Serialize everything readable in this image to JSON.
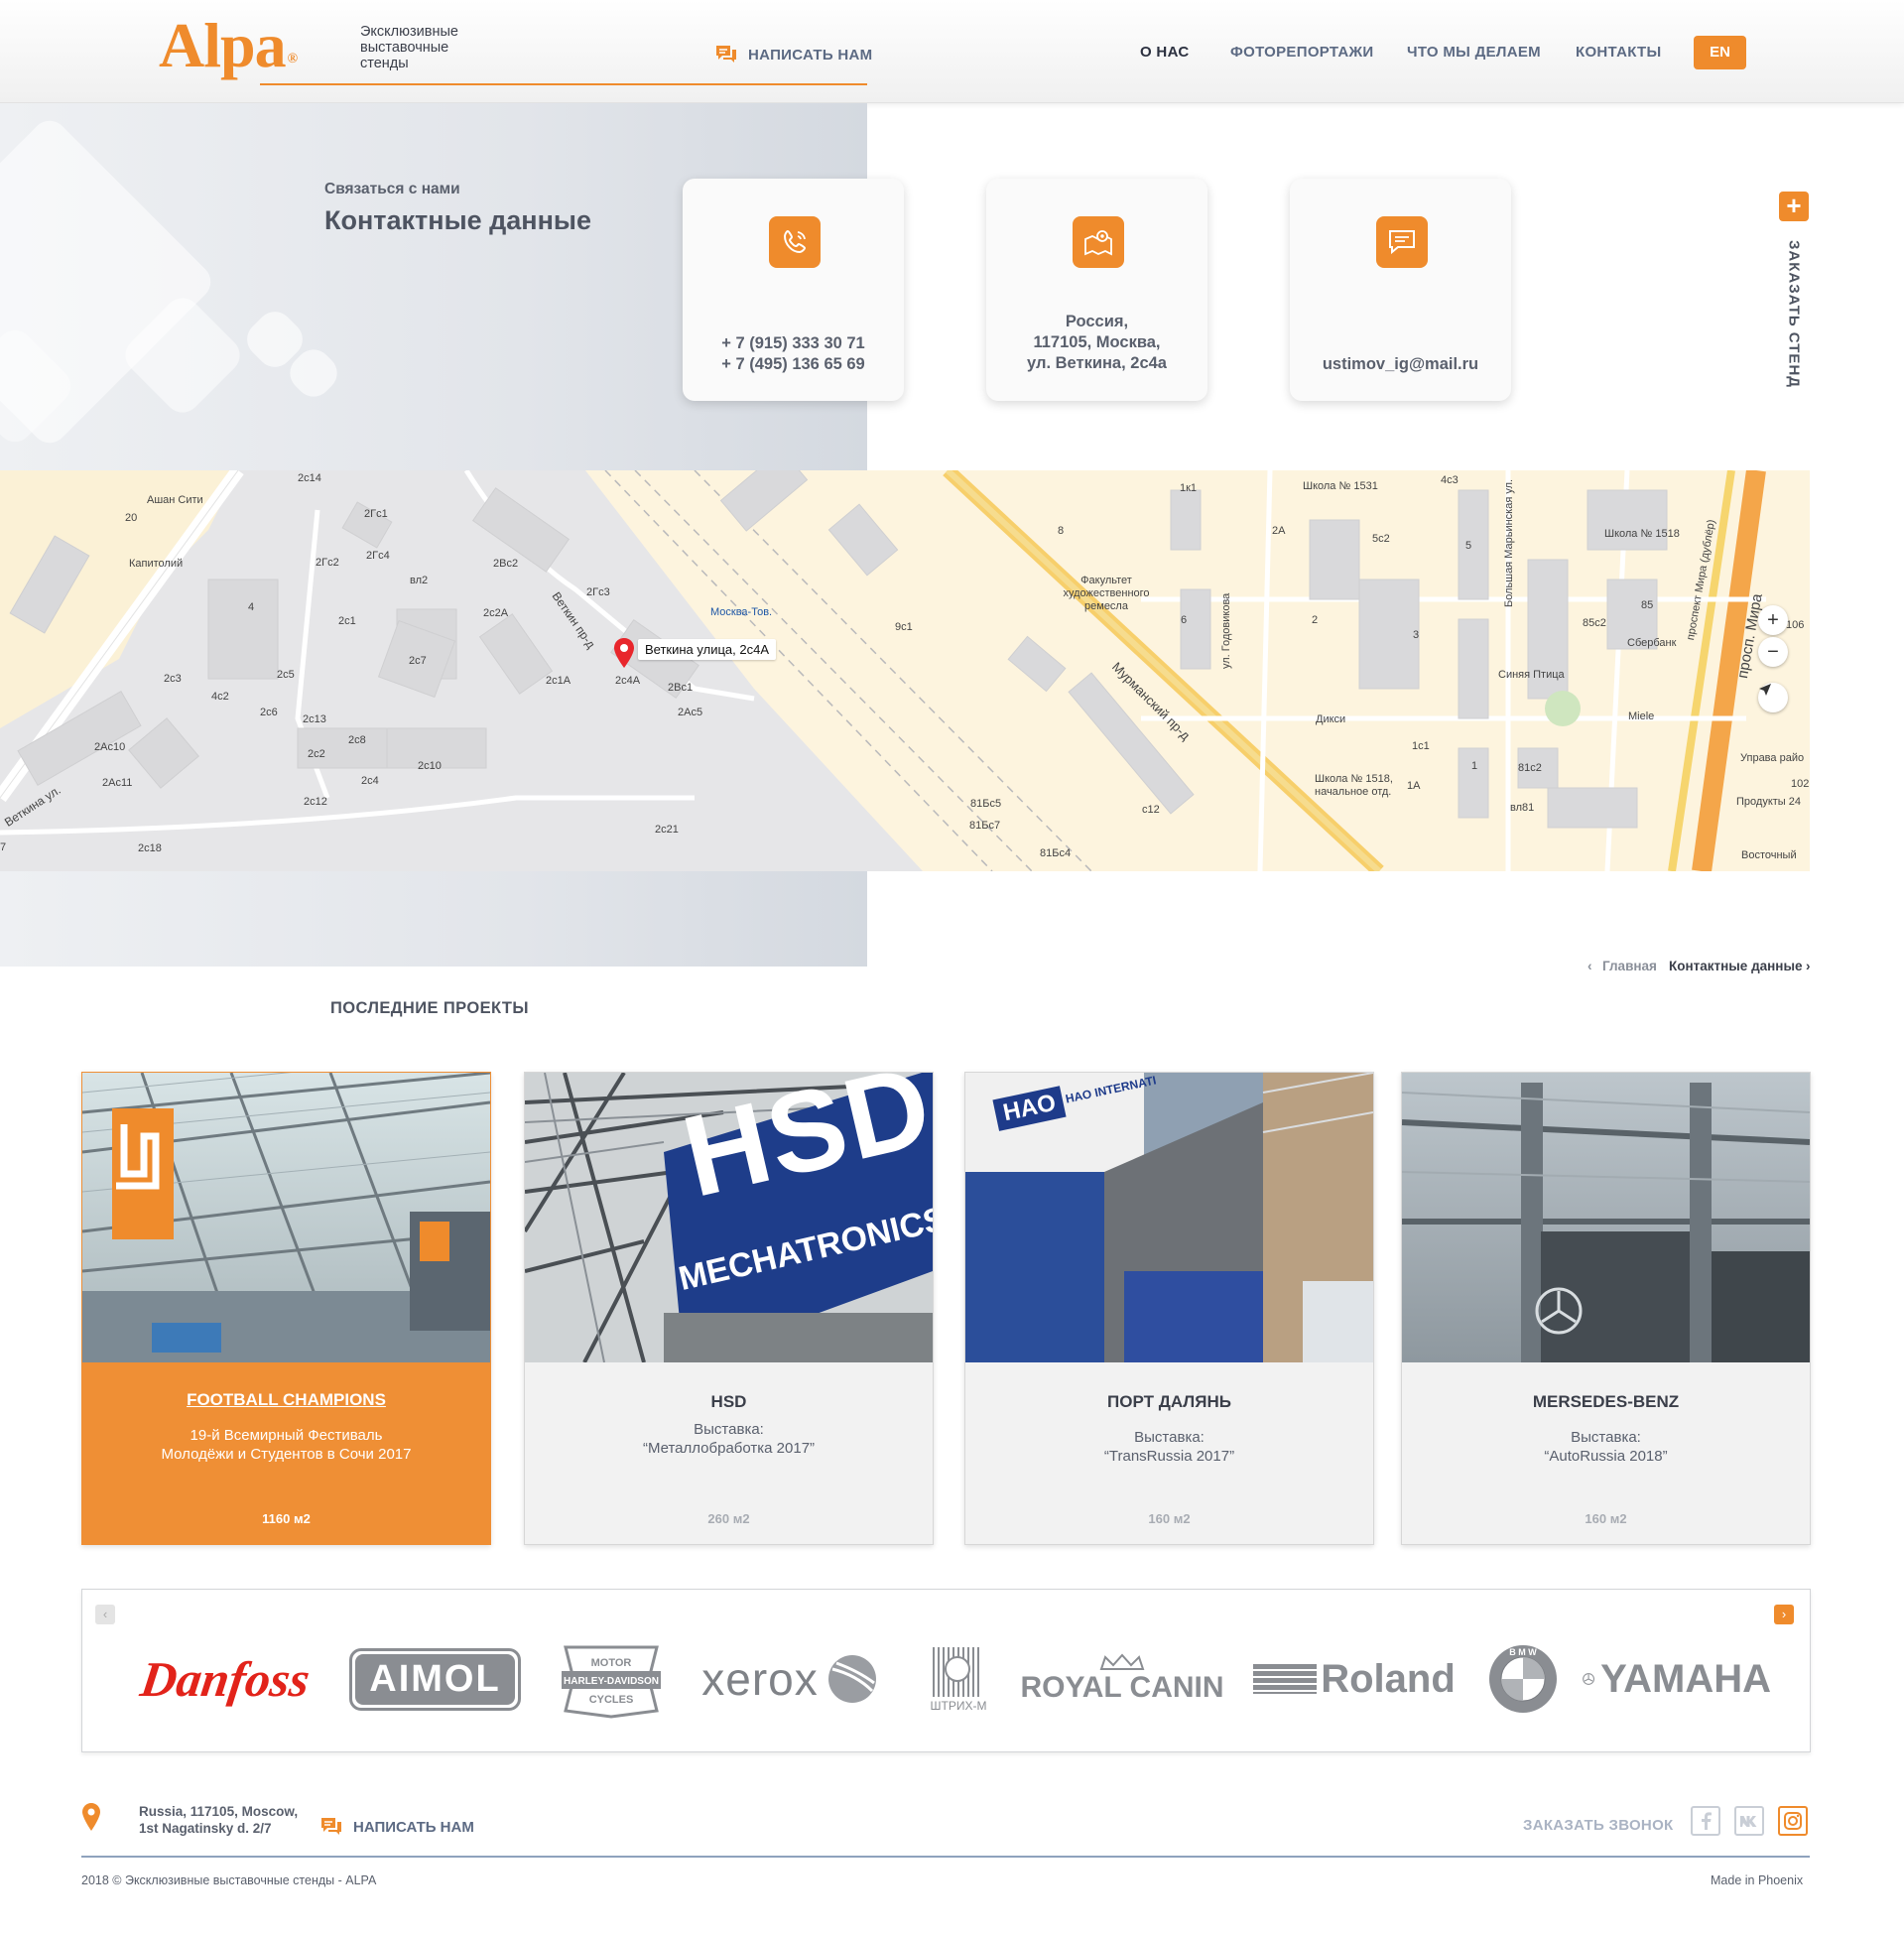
{
  "header": {
    "logo_text": "Alpa",
    "logo_mark": "®",
    "tagline": "Эксклюзивные выставочные стенды",
    "write_us_label": "НАПИСАТЬ НАМ",
    "nav": [
      "О НАС",
      "ФОТОРЕПОРТАЖИ",
      "ЧТО МЫ ДЕЛАЕМ",
      "КОНТАКТЫ"
    ],
    "lang_label": "EN"
  },
  "contacts": {
    "subtitle": "Связаться с нами",
    "title": "Контактные данные",
    "phone_lines": [
      "+ 7 (915) 333 30 71",
      "+ 7 (495) 136 65 69"
    ],
    "address_lines": [
      "Россия,",
      "117105, Москва,",
      "ул. Веткина, 2с4а"
    ],
    "email": "ustimov_ig@mail.ru",
    "order_plus": "+",
    "order_label": "ЗАКАЗАТЬ СТЕНД"
  },
  "map": {
    "pin_label": "Веткина улица, 2с4А",
    "labels": [
      "2с14",
      "Ашан Сити",
      "20",
      "Капитолий",
      "4",
      "2Гс1",
      "2Гс2",
      "2Гс4",
      "вл2",
      "2Вс2",
      "2Гс3",
      "2с2А",
      "2с1",
      "2с7",
      "2с5",
      "2с3",
      "4с2",
      "2с6",
      "2с13",
      "2Ас10",
      "2Ас11",
      "2с2",
      "2с8",
      "2с4",
      "2с10",
      "2с12",
      "2с18",
      "2с1А",
      "2с4А",
      "2Вс1",
      "2Ас5",
      "2с21",
      "Москва-Тов.",
      "9с1",
      "8",
      "Факультет художественного ремесла",
      "81Бс5",
      "81Бс7",
      "81Бс4",
      "с12",
      "Мурманский пр-д",
      "1к1",
      "Школа № 1531",
      "4с3",
      "2А",
      "5с2",
      "5",
      "6",
      "2",
      "3",
      "ул. Годовикова",
      "Дикси",
      "Большая Марьинская ул.",
      "Синяя Птица",
      "Школа № 1518",
      "85",
      "85с2",
      "Сбербанк",
      "1с1",
      "1А",
      "1",
      "Школа № 1518, начальное отд.",
      "81с2",
      "вл81",
      "Miele",
      "проспект Мира (дублёр)",
      "просп. Мира",
      "106",
      "Управа райо",
      "102",
      "Продукты 24",
      "Восточный",
      "Веткина ул.",
      "Веткин пр-д",
      "7"
    ],
    "zoom_in": "+",
    "zoom_out": "−"
  },
  "breadcrumbs": {
    "home": "Главная",
    "current": "Контактные данные",
    "sep_left": "‹",
    "sep_right": "›"
  },
  "projects": {
    "title": "ПОСЛЕДНИЕ ПРОЕКТЫ",
    "items": [
      {
        "name": "FOOTBALL CHAMPIONS",
        "desc_lines": [
          "19-й Всемирный Фестиваль",
          "Молодёжи и Студентов в Сочи 2017"
        ],
        "area": "1160 м2",
        "highlight": true
      },
      {
        "name": "HSD",
        "desc_lines": [
          "Выставка:",
          "“Металлобработка 2017”"
        ],
        "area": "260 м2",
        "highlight": false
      },
      {
        "name": "ПОРТ ДАЛЯНЬ",
        "desc_lines": [
          "Выставка:",
          "“TransRussia 2017”"
        ],
        "area": "160 м2",
        "highlight": false
      },
      {
        "name": "MERSEDES-BENZ",
        "desc_lines": [
          "Выставка:",
          "“AutoRussia 2018”"
        ],
        "area": "160 м2",
        "highlight": false
      }
    ],
    "photo_text": {
      "hsd_1": "HSD",
      "hsd_2": "MECHATRONICS",
      "hao": "HAO",
      "hao_intl": "HAO INTERNATI"
    }
  },
  "clients": {
    "prev_arrow": "‹",
    "next_arrow": "›",
    "logos": [
      "Danfoss",
      "AIMOL",
      "HARLEY-DAVIDSON",
      "xerox",
      "ШТРИХ-М",
      "ROYAL CANIN",
      "Roland",
      "BMW",
      "YAMAHA"
    ],
    "logo_details": {
      "harley_top": "MOTOR",
      "harley_bottom": "CYCLES",
      "royal_canin": "ROYAL CANIN",
      "bmw_letters": "B M W"
    }
  },
  "footer": {
    "address_lines": [
      "Russia, 117105, Moscow,",
      "1st Nagatinsky d. 2/7"
    ],
    "write_us_label": "НАПИСАТЬ НАМ",
    "call_label": "ЗАКАЗАТЬ ЗВОНОК",
    "social": [
      "facebook",
      "vk",
      "instagram"
    ],
    "copyright": "2018 © Эксклюзивные выставочные стенды - ALPA",
    "made_in": "Made in Phoenix"
  },
  "colors": {
    "accent": "#ef8b2c",
    "text": "#4a4f5c",
    "nav": "#5c6a83"
  }
}
